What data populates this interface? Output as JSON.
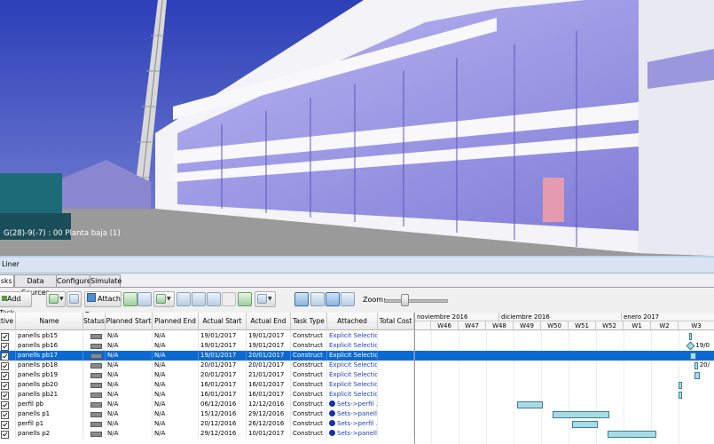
{
  "viewport": {
    "location_label": "G(28)-9(-7) : 00 Planta baja (1)"
  },
  "panel": {
    "title": "Liner",
    "tabs": [
      "Tasks",
      "Data Sources",
      "Configure",
      "Simulate"
    ],
    "active_tab": "Tasks"
  },
  "toolbar": {
    "add_task": "Add Task",
    "attach": "Attach",
    "zoom_label": "Zoom:"
  },
  "columns": [
    "Active",
    "Name",
    "Status",
    "Planned Start",
    "Planned End",
    "Actual Start",
    "Actual End",
    "Task Type",
    "Attached",
    "Total Cost"
  ],
  "rows": [
    {
      "name": "panells pb15",
      "status": "",
      "planned_start": "N/A",
      "planned_end": "N/A",
      "actual_start": "19/01/2017",
      "actual_end": "19/01/2017",
      "type": "Construct",
      "attached": "Explicit Selection",
      "sets": false,
      "selected": false
    },
    {
      "name": "panells pb16",
      "status": "",
      "planned_start": "N/A",
      "planned_end": "N/A",
      "actual_start": "19/01/2017",
      "actual_end": "19/01/2017",
      "type": "Construct",
      "attached": "Explicit Selection",
      "sets": false,
      "selected": false
    },
    {
      "name": "panells pb17",
      "status": "",
      "planned_start": "N/A",
      "planned_end": "N/A",
      "actual_start": "19/01/2017",
      "actual_end": "20/01/2017",
      "type": "Construct",
      "attached": "Explicit Selection",
      "sets": false,
      "selected": true
    },
    {
      "name": "panells pb18",
      "status": "",
      "planned_start": "N/A",
      "planned_end": "N/A",
      "actual_start": "20/01/2017",
      "actual_end": "20/01/2017",
      "type": "Construct",
      "attached": "Explicit Selection",
      "sets": false,
      "selected": false
    },
    {
      "name": "panells pb19",
      "status": "",
      "planned_start": "N/A",
      "planned_end": "N/A",
      "actual_start": "20/01/2017",
      "actual_end": "21/01/2017",
      "type": "Construct",
      "attached": "Explicit Selection",
      "sets": false,
      "selected": false
    },
    {
      "name": "panells pb20",
      "status": "",
      "planned_start": "N/A",
      "planned_end": "N/A",
      "actual_start": "16/01/2017",
      "actual_end": "16/01/2017",
      "type": "Construct",
      "attached": "Explicit Selection",
      "sets": false,
      "selected": false
    },
    {
      "name": "panells pb21",
      "status": "",
      "planned_start": "N/A",
      "planned_end": "N/A",
      "actual_start": "16/01/2017",
      "actual_end": "16/01/2017",
      "type": "Construct",
      "attached": "Explicit Selection",
      "sets": false,
      "selected": false
    },
    {
      "name": "perfil pb",
      "status": "",
      "planned_start": "N/A",
      "planned_end": "N/A",
      "actual_start": "06/12/2016",
      "actual_end": "12/12/2016",
      "type": "Construct",
      "attached": "Sets->perfil ...",
      "sets": true,
      "selected": false
    },
    {
      "name": "panells p1",
      "status": "",
      "planned_start": "N/A",
      "planned_end": "N/A",
      "actual_start": "15/12/2016",
      "actual_end": "29/12/2016",
      "type": "Construct",
      "attached": "Sets->panell...",
      "sets": true,
      "selected": false
    },
    {
      "name": "perfil p1",
      "status": "",
      "planned_start": "N/A",
      "planned_end": "N/A",
      "actual_start": "20/12/2016",
      "actual_end": "26/12/2016",
      "type": "Construct",
      "attached": "Sets->perfil ...",
      "sets": true,
      "selected": false
    },
    {
      "name": "panells p2",
      "status": "",
      "planned_start": "N/A",
      "planned_end": "N/A",
      "actual_start": "29/12/2016",
      "actual_end": "10/01/2017",
      "type": "Construct",
      "attached": "Sets->panell...",
      "sets": true,
      "selected": false
    }
  ],
  "gantt": {
    "months": [
      "noviembre 2016",
      "diciembre 2016",
      "enero 2017"
    ],
    "weeks": [
      "W46",
      "W47",
      "W48",
      "W49",
      "W50",
      "W51",
      "W52",
      "W1",
      "W2",
      "W3"
    ],
    "visible_date_labels": [
      "19/0",
      "20/"
    ]
  }
}
